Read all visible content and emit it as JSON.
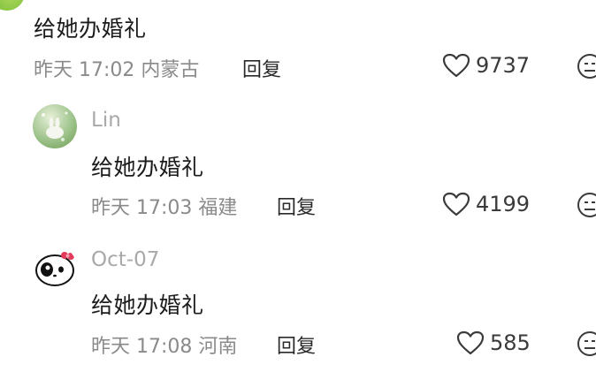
{
  "comments": [
    {
      "text": "给她办婚礼",
      "date": "昨天",
      "time": "17:02",
      "location": "内蒙古",
      "reply_label": "回复",
      "likes": "9737"
    },
    {
      "username": "Lin",
      "text": "给她办婚礼",
      "date": "昨天",
      "time": "17:03",
      "location": "福建",
      "reply_label": "回复",
      "likes": "4199"
    },
    {
      "username": "Oct-07",
      "text": "给她办婚礼",
      "date": "昨天",
      "time": "17:08",
      "location": "河南",
      "reply_label": "回复",
      "likes": "585"
    }
  ],
  "icons": {
    "like": "heart-outline-icon",
    "dislike": "neutral-face-icon"
  }
}
